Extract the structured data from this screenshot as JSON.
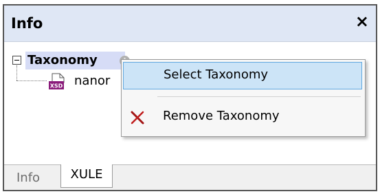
{
  "panel": {
    "title": "Info",
    "close_glyph": "×"
  },
  "tree": {
    "root_label": "Taxonomy",
    "root_info_glyph": "i",
    "child_icon_text": "XSD",
    "child_label": "nanor"
  },
  "context_menu": {
    "items": [
      {
        "label": "Select Taxonomy",
        "icon": "none"
      },
      {
        "label": "Remove Taxonomy",
        "icon": "remove-x-icon"
      }
    ]
  },
  "tabs": [
    {
      "label": "Info",
      "active": false
    },
    {
      "label": "XULE",
      "active": true
    }
  ],
  "colors": {
    "titlebar": "#dfe7f5",
    "selection": "#d6dcf6",
    "menu_highlight": "#cce4f7",
    "menu_highlight_border": "#5fa7df",
    "xsd_icon": "#8a1b7a",
    "remove_icon": "#a31515"
  }
}
